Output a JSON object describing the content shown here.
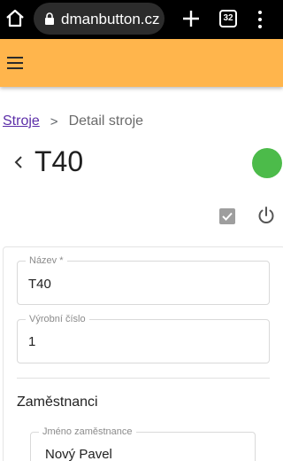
{
  "browser": {
    "url": "dmanbutton.cz",
    "tab_count": "32",
    "icons": [
      "home-icon",
      "lock-icon",
      "plus-icon",
      "tabs-icon",
      "more-vert-icon"
    ]
  },
  "app_bar": {
    "color": "#ffb54c",
    "menu_icon": "menu-icon"
  },
  "breadcrumb": {
    "parent": "Stroje",
    "separator": ">",
    "current": "Detail stroje"
  },
  "page": {
    "title": "T40",
    "status_color": "#4cbb4a"
  },
  "actions": {
    "icons": [
      "check-box-icon",
      "power-icon"
    ]
  },
  "form": {
    "name_label": "Název *",
    "name_value": "T40",
    "serial_label": "Výrobní číslo",
    "serial_value": "1",
    "employees_title": "Zaměstnanci",
    "employee_label": "Jméno zaměstnance",
    "employee_value": "Nový Pavel"
  }
}
